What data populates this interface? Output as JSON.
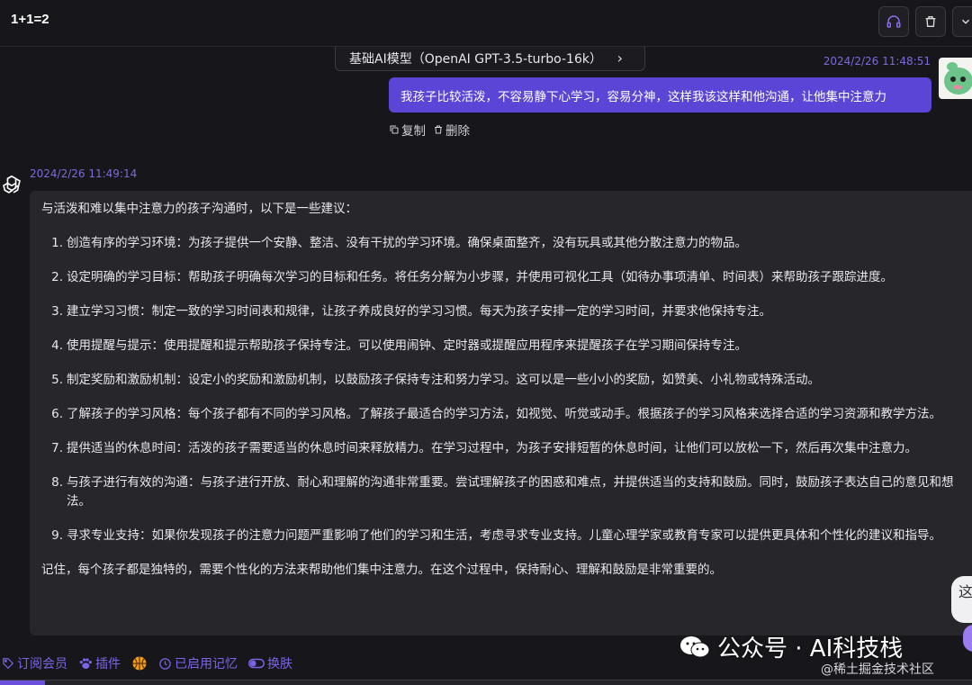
{
  "header": {
    "title": "1+1=2"
  },
  "model_selector": {
    "label": "基础AI模型（OpenAI GPT-3.5-turbo-16k）"
  },
  "user_message": {
    "time": "2024/2/26 11:48:51",
    "text": "我孩子比较活泼，不容易静下心学习，容易分神，这样我该这样和他沟通，让他集中注意力",
    "copy_label": "复制",
    "delete_label": "删除"
  },
  "bot_message": {
    "time": "2024/2/26 11:49:14",
    "intro": "与活泼和难以集中注意力的孩子沟通时，以下是一些建议：",
    "items": [
      {
        "num": "1.",
        "text": "创造有序的学习环境：为孩子提供一个安静、整洁、没有干扰的学习环境。确保桌面整齐，没有玩具或其他分散注意力的物品。"
      },
      {
        "num": "2.",
        "text": "设定明确的学习目标：帮助孩子明确每次学习的目标和任务。将任务分解为小步骤，并使用可视化工具（如待办事项清单、时间表）来帮助孩子跟踪进度。"
      },
      {
        "num": "3.",
        "text": "建立学习习惯：制定一致的学习时间表和规律，让孩子养成良好的学习习惯。每天为孩子安排一定的学习时间，并要求他保持专注。"
      },
      {
        "num": "4.",
        "text": "使用提醒与提示：使用提醒和提示帮助孩子保持专注。可以使用闹钟、定时器或提醒应用程序来提醒孩子在学习期间保持专注。"
      },
      {
        "num": "5.",
        "text": "制定奖励和激励机制：设定小的奖励和激励机制，以鼓励孩子保持专注和努力学习。这可以是一些小小的奖励，如赞美、小礼物或特殊活动。"
      },
      {
        "num": "6.",
        "text": "了解孩子的学习风格：每个孩子都有不同的学习风格。了解孩子最适合的学习方法，如视觉、听觉或动手。根据孩子的学习风格来选择合适的学习资源和教学方法。"
      },
      {
        "num": "7.",
        "text": "提供适当的休息时间：活泼的孩子需要适当的休息时间来释放精力。在学习过程中，为孩子安排短暂的休息时间，让他们可以放松一下，然后再次集中注意力。"
      },
      {
        "num": "8.",
        "text": "与孩子进行有效的沟通：与孩子进行开放、耐心和理解的沟通非常重要。尝试理解孩子的困惑和难点，并提供适当的支持和鼓励。同时，鼓励孩子表达自己的意见和想法。"
      },
      {
        "num": "9.",
        "text": "寻求专业支持：如果你发现孩子的注意力问题严重影响了他们的学习和生活，考虑寻求专业支持。儿童心理学家或教育专家可以提供更具体和个性化的建议和指导。"
      }
    ],
    "outro": "记住，每个孩子都是独特的，需要个性化的方法来帮助他们集中注意力。在这个过程中，保持耐心、理解和鼓励是非常重要的。"
  },
  "toolbar": {
    "subscribe": "订阅会员",
    "plugins": "插件",
    "memory": "已启用记忆",
    "skin": "换肤"
  },
  "watermark": {
    "main": "公众号 · AI科技栈",
    "sub": "@稀土掘金技术社区"
  },
  "side_float": {
    "text": "这"
  },
  "colors": {
    "background": "#17171b",
    "accent": "#5b45d6",
    "time_text": "#7b6bd6",
    "toolbar_text": "#7d63e8",
    "bubble_bg": "#26262b"
  },
  "icons": {
    "header_buttons": [
      "headset-icon",
      "trash-icon",
      "chevron-down-icon"
    ],
    "copy": "copy-icon",
    "delete": "delete-icon",
    "bot": "openai-logo-icon"
  }
}
